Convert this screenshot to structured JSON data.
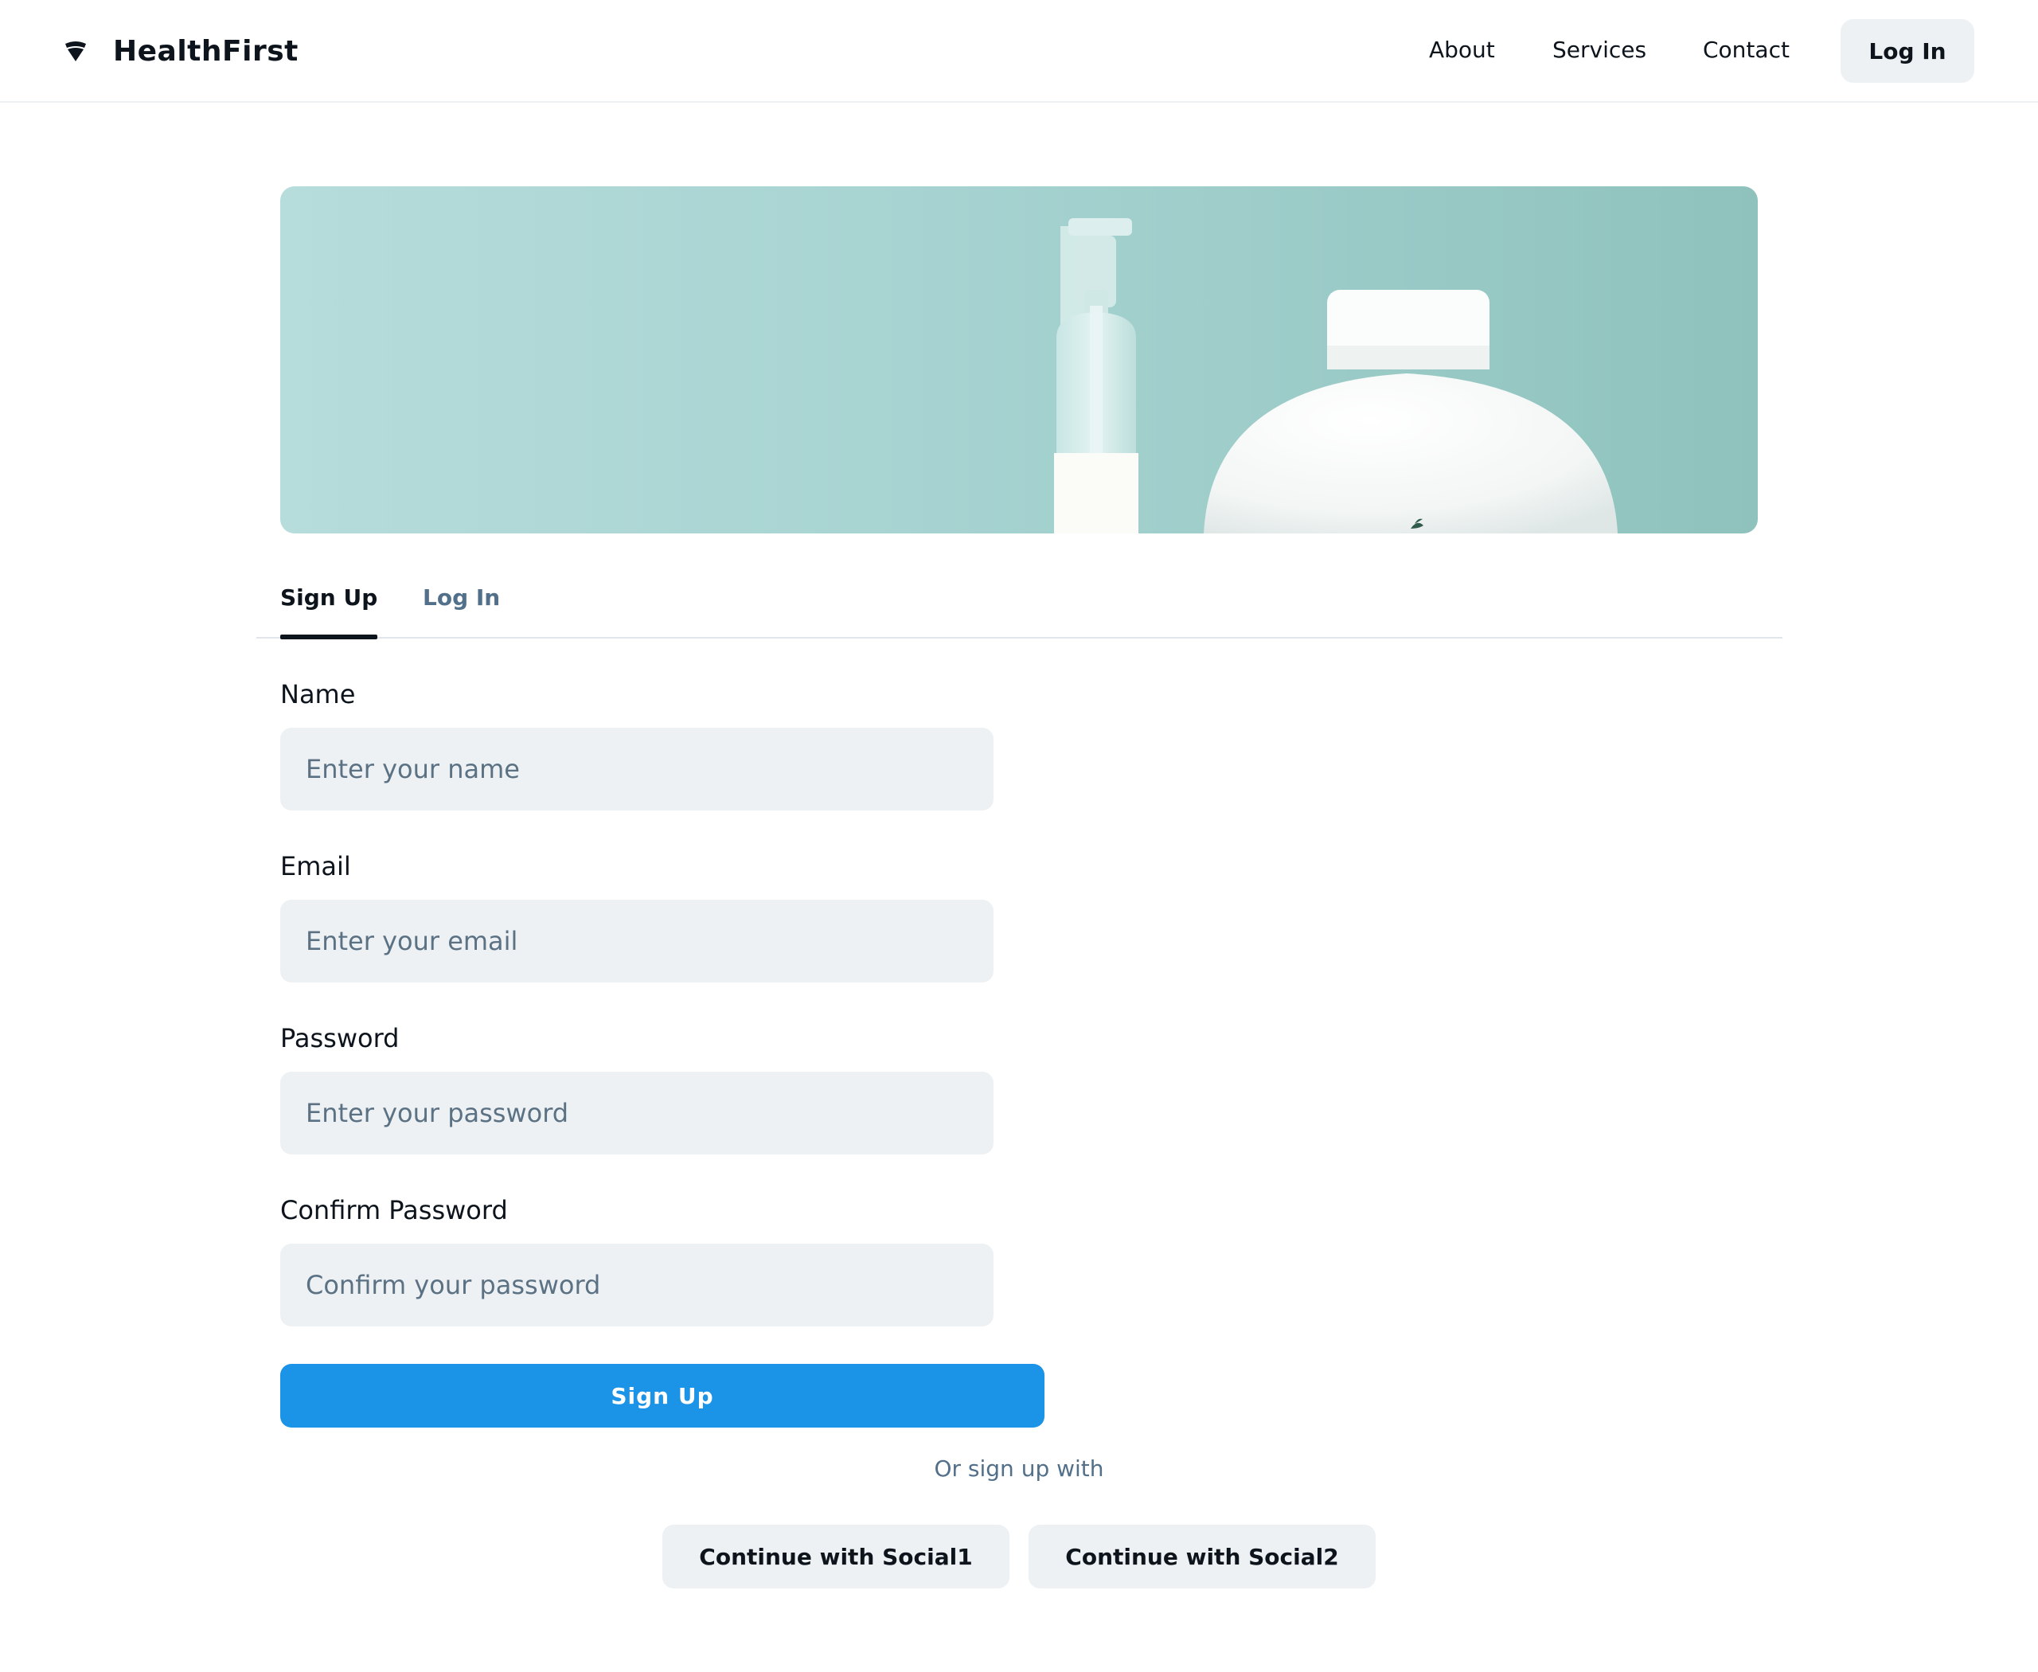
{
  "header": {
    "brand": "HealthFirst",
    "brand_icon": "shield-logo-icon",
    "nav": [
      {
        "label": "About"
      },
      {
        "label": "Services"
      },
      {
        "label": "Contact"
      }
    ],
    "login_label": "Log In"
  },
  "hero": {
    "image": "skincare-bottles-photo",
    "background_color": "#a6d3d1"
  },
  "tabs": [
    {
      "label": "Sign Up",
      "active": true
    },
    {
      "label": "Log In",
      "active": false
    }
  ],
  "form": {
    "name": {
      "label": "Name",
      "placeholder": "Enter your name",
      "value": ""
    },
    "email": {
      "label": "Email",
      "placeholder": "Enter your email",
      "value": ""
    },
    "password": {
      "label": "Password",
      "placeholder": "Enter your password",
      "value": ""
    },
    "confirm_password": {
      "label": "Confirm Password",
      "placeholder": "Confirm your password",
      "value": ""
    },
    "submit_label": "Sign Up"
  },
  "social": {
    "divider_text": "Or sign up with",
    "buttons": [
      {
        "label": "Continue with Social1"
      },
      {
        "label": "Continue with Social2"
      }
    ]
  },
  "colors": {
    "primary": "#1b93e6",
    "text": "#0d141c",
    "muted": "#52708a",
    "input_bg": "#eef1f3"
  }
}
